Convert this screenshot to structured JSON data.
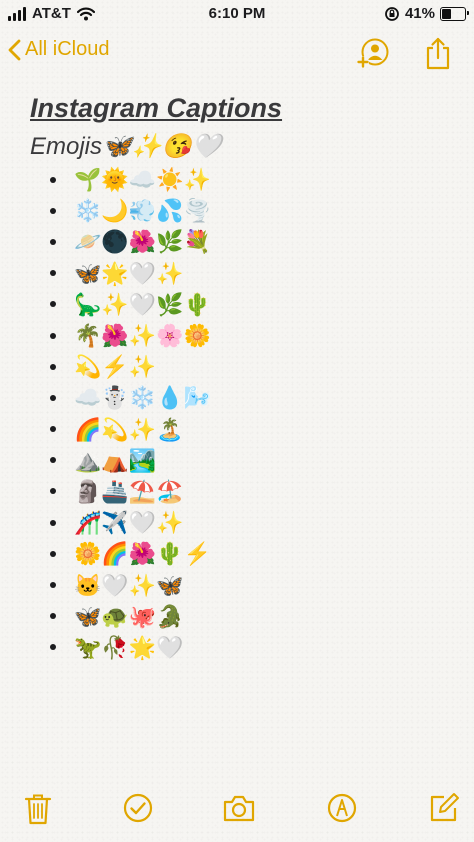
{
  "status_bar": {
    "carrier": "AT&T",
    "time": "6:10 PM",
    "battery": "41%",
    "battery_level": 0.41
  },
  "nav": {
    "back_label": "All iCloud"
  },
  "note": {
    "title": "Instagram Captions",
    "subtitle": "Emojis",
    "subtitle_emojis": "🦋✨😘🤍",
    "lines": [
      "🌱🌞☁️☀️✨",
      "❄️🌙💨💦🌪️",
      "🪐🌑🌺🌿💐",
      "🦋🌟🤍✨",
      "🦕✨🤍🌿🌵",
      "🌴🌺✨🌸🌼",
      "💫⚡✨",
      "☁️☃️❄️💧🌬️",
      "🌈💫✨🏝️",
      "⛰️⛺🏞️",
      "🗿🚢⛱️🏖️",
      "🎢✈️🤍✨",
      "🌼🌈🌺🌵⚡",
      "🐱🤍✨🦋",
      "🦋🐢🐙🐊",
      "🦖🥀🌟🤍"
    ]
  },
  "colors": {
    "accent": "#e0a600",
    "background": "#f6f5f2",
    "text": "#3a3a3c"
  },
  "icons": {
    "share": "add-person-icon",
    "export": "share-icon",
    "toolbar": [
      "trash-icon",
      "checklist-icon",
      "camera-icon",
      "markup-icon",
      "compose-icon"
    ]
  }
}
